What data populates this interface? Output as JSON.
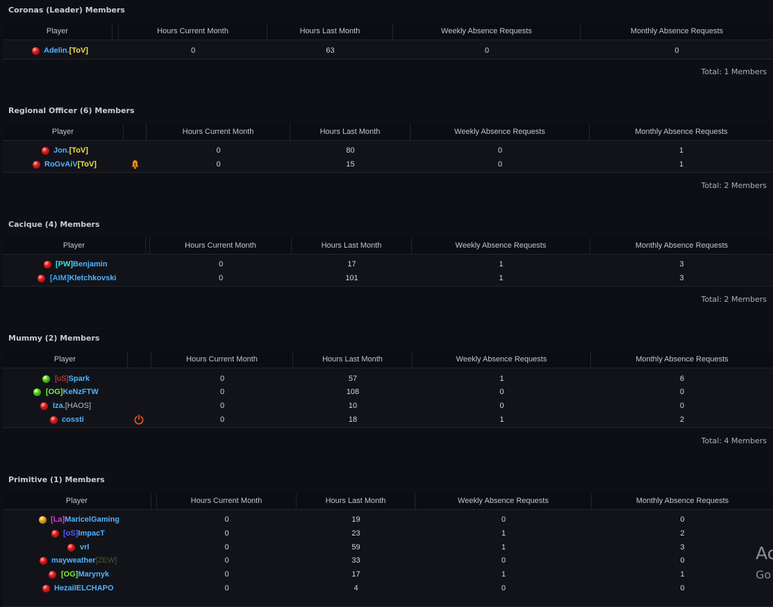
{
  "columns": {
    "player": "Player",
    "hours_current": "Hours Current Month",
    "hours_last": "Hours Last Month",
    "weekly": "Weekly Absence Requests",
    "monthly": "Monthly Absence Requests"
  },
  "sections": [
    {
      "title": "Coronas (Leader) Members",
      "total": "Total: 1 Members",
      "members": [
        {
          "status": "red",
          "prefix": "",
          "name": "Adelin.",
          "suffix": "[ToV]",
          "hours_current": "0",
          "hours_last": "63",
          "weekly": "0",
          "monthly": "0"
        }
      ]
    },
    {
      "title": "Regional Officer (6) Members",
      "total": "Total: 2 Members",
      "members": [
        {
          "status": "red",
          "prefix": "",
          "name": "Jon.",
          "suffix": "[ToV]",
          "hours_current": "0",
          "hours_last": "80",
          "weekly": "0",
          "monthly": "1"
        },
        {
          "status": "red",
          "prefix": "",
          "name": "RoGvAiV",
          "suffix": "[ToV]",
          "hours_current": "0",
          "hours_last": "15",
          "weekly": "0",
          "monthly": "1",
          "icon": "bell-icon"
        }
      ]
    },
    {
      "title": "Cacique (4) Members",
      "total": "Total: 2 Members",
      "members": [
        {
          "status": "red",
          "prefix": "[PW]",
          "name": "Benjamin",
          "suffix": "",
          "hours_current": "0",
          "hours_last": "17",
          "weekly": "1",
          "monthly": "3"
        },
        {
          "status": "red",
          "prefix": "[AIM]",
          "name": "Kletchkovski",
          "suffix": "",
          "hours_current": "0",
          "hours_last": "101",
          "weekly": "1",
          "monthly": "3"
        }
      ]
    },
    {
      "title": "Mummy (2) Members",
      "total": "Total: 4 Members",
      "members": [
        {
          "status": "green",
          "prefix": "[uS]",
          "name": "Spark",
          "suffix": "",
          "hours_current": "0",
          "hours_last": "57",
          "weekly": "1",
          "monthly": "6"
        },
        {
          "status": "green",
          "prefix": "[OG]",
          "name": "KeNzFTW",
          "suffix": "",
          "hours_current": "0",
          "hours_last": "108",
          "weekly": "0",
          "monthly": "0"
        },
        {
          "status": "red",
          "prefix": "",
          "name": "Iza.",
          "suffix": "[HAOS]",
          "hours_current": "0",
          "hours_last": "10",
          "weekly": "0",
          "monthly": "0"
        },
        {
          "status": "red",
          "prefix": "",
          "name": "cossti",
          "suffix": "",
          "hours_current": "0",
          "hours_last": "18",
          "weekly": "1",
          "monthly": "2",
          "icon": "power-icon"
        }
      ]
    },
    {
      "title": "Primitive (1) Members",
      "total": "",
      "members": [
        {
          "status": "orange",
          "prefix": "[La]",
          "name": "MaricelGaming",
          "suffix": "",
          "hours_current": "0",
          "hours_last": "19",
          "weekly": "0",
          "monthly": "0"
        },
        {
          "status": "red",
          "prefix": "[oS]",
          "name": "ImpacT",
          "suffix": "",
          "hours_current": "0",
          "hours_last": "23",
          "weekly": "1",
          "monthly": "2"
        },
        {
          "status": "red",
          "prefix": "",
          "name": "vrl",
          "suffix": "",
          "hours_current": "0",
          "hours_last": "59",
          "weekly": "1",
          "monthly": "3"
        },
        {
          "status": "red",
          "prefix": "",
          "name": "mayweather",
          "suffix": "[ZEW]",
          "hours_current": "0",
          "hours_last": "33",
          "weekly": "0",
          "monthly": "0"
        },
        {
          "status": "red",
          "prefix": "[OG]",
          "name": "Marynyk",
          "suffix": "",
          "hours_current": "0",
          "hours_last": "17",
          "weekly": "1",
          "monthly": "1"
        },
        {
          "status": "red",
          "prefix": "",
          "name": "HezailELCHAPO",
          "suffix": "",
          "hours_current": "0",
          "hours_last": "4",
          "weekly": "0",
          "monthly": "0"
        }
      ]
    }
  ],
  "watermark": {
    "line1": "Ac",
    "line2": "Go"
  }
}
